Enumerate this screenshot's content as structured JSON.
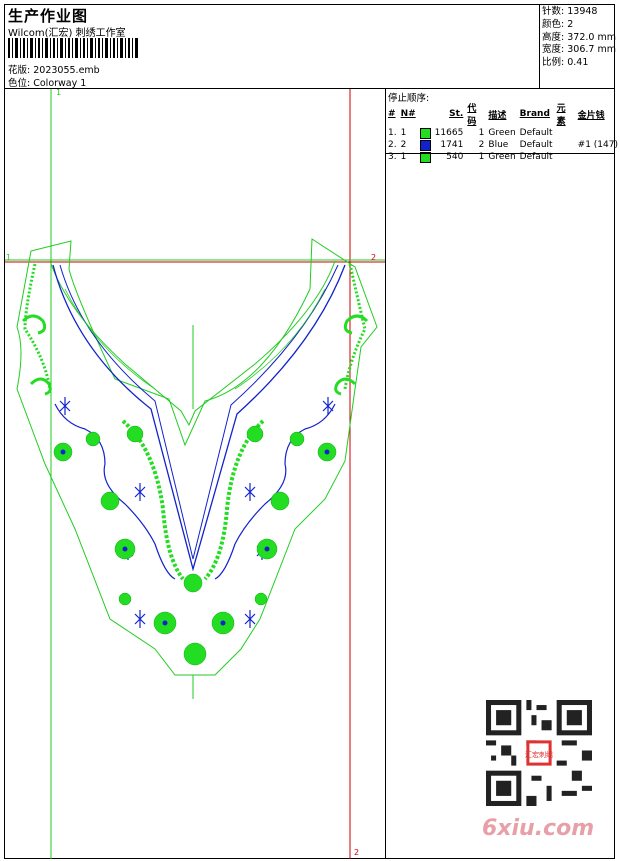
{
  "header": {
    "title": "生产作业图",
    "subtitle": "Wilcom(汇宏) 刺绣工作室",
    "design_label": "花版:",
    "design_file": "2023055.emb",
    "colorway_label": "色位:",
    "colorway": "Colorway 1"
  },
  "stats": [
    {
      "label": "针数:",
      "value": "13948"
    },
    {
      "label": "颜色:",
      "value": "2"
    },
    {
      "label": "高度:",
      "value": "372.0 mm"
    },
    {
      "label": "宽度:",
      "value": "306.7 mm"
    },
    {
      "label": "比例:",
      "value": "0.41"
    }
  ],
  "stop_sequence": {
    "title": "停止顺序:",
    "columns": [
      "#",
      "N#",
      "St.",
      "代码",
      "描述",
      "Brand",
      "元素",
      "金片钱"
    ],
    "rows": [
      {
        "idx": "1.",
        "n": "1",
        "color": "#22dd22",
        "st": "11665",
        "code": "1",
        "desc": "Green",
        "brand": "Default",
        "elem": "",
        "seq": ""
      },
      {
        "idx": "2.",
        "n": "2",
        "color": "#1122cc",
        "st": "1741",
        "code": "2",
        "desc": "Blue",
        "brand": "Default",
        "elem": "",
        "seq": "#1 (147)"
      },
      {
        "idx": "3.",
        "n": "1",
        "color": "#22dd22",
        "st": "540",
        "code": "1",
        "desc": "Green",
        "brand": "Default",
        "elem": "",
        "seq": ""
      }
    ]
  },
  "guides": {
    "v1": "1",
    "v2": "2",
    "h1": "1",
    "h2": "2",
    "v2_bottom": "2"
  },
  "watermark": {
    "text": "6xiu.com",
    "seal": "汇宏刺绣"
  },
  "colors": {
    "green": "#22dd22",
    "blue": "#1122cc",
    "guide_green": "#22cc22",
    "guide_red": "#cc0000"
  }
}
